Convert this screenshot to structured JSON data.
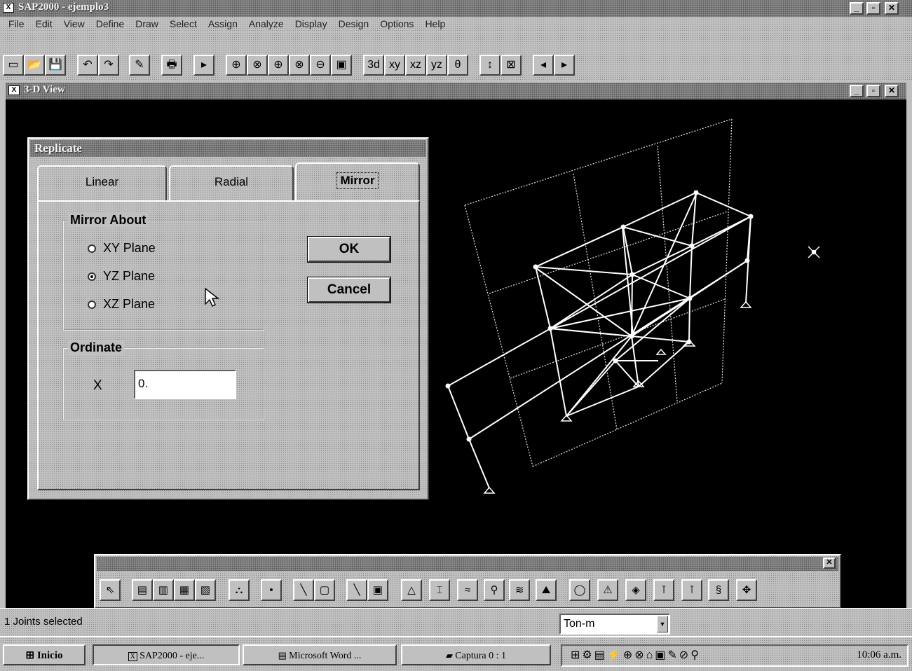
{
  "app": {
    "title": "SAP2000 - ejemplo3",
    "caption_buttons": [
      "_",
      "▫",
      "✕"
    ]
  },
  "menu": [
    "File",
    "Edit",
    "View",
    "Define",
    "Draw",
    "Select",
    "Assign",
    "Analyze",
    "Display",
    "Design",
    "Options",
    "Help"
  ],
  "toolbar": {
    "buttons": [
      "▭",
      "📂",
      "💾",
      "↶",
      "↷",
      "✎",
      "🖶",
      "▸",
      "⊕",
      "⊗",
      "⊕",
      "⊗",
      "⊖",
      "▣",
      "3d",
      "xy",
      "xz",
      "yz",
      "θ",
      "↕",
      "⊠",
      "◂",
      "▸"
    ]
  },
  "view_window": {
    "title": "3-D View",
    "caption_buttons": [
      "_",
      "▫",
      "✕"
    ]
  },
  "dialog": {
    "title": "Replicate",
    "tabs": [
      "Linear",
      "Radial",
      "Mirror"
    ],
    "active_tab": "Mirror",
    "mirror_group": {
      "title": "Mirror About",
      "options": [
        "XY Plane",
        "YZ Plane",
        "XZ Plane"
      ],
      "selected": "YZ Plane"
    },
    "ordinate_group": {
      "title": "Ordinate",
      "label": "X",
      "value": "0."
    },
    "ok_label": "OK",
    "cancel_label": "Cancel"
  },
  "palette": {
    "close": "✕",
    "buttons": [
      "⇖",
      "▤",
      "▥",
      "▦",
      "▧",
      "⛬",
      "•",
      "╲",
      "▢",
      "╲",
      "▣",
      "△",
      "⌶",
      "≈",
      "⚲",
      "≋",
      "⛰",
      "◯",
      "⚠",
      "◈",
      "⊺",
      "⊺",
      "§",
      "✥"
    ]
  },
  "status": {
    "text": "1 Joints selected",
    "units": "Ton-m"
  },
  "taskbar": {
    "start": "Inicio",
    "tasks": [
      "SAP2000 - eje...",
      "Microsoft Word ...",
      "Captura 0 : 1"
    ],
    "time": "10:06 a.m."
  },
  "colors": {
    "view_background": "#000000",
    "frame_lines": "#ffffff",
    "grid_lines": "#d8d8d8",
    "title_bar": "#8a8a8a"
  }
}
